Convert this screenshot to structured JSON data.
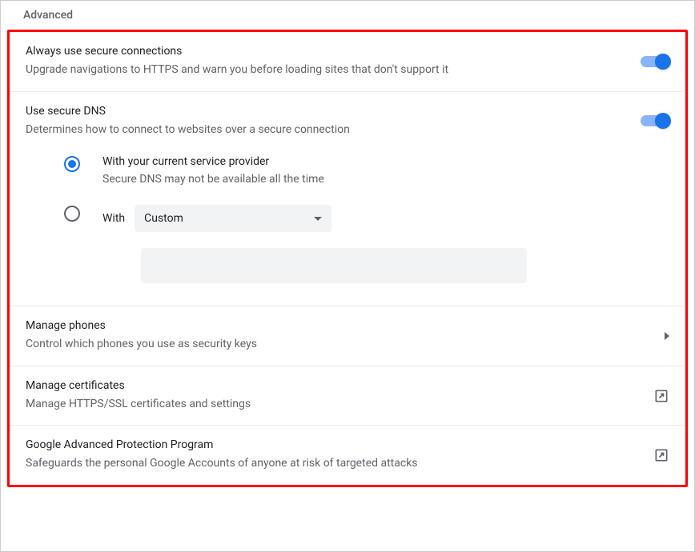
{
  "sectionHeader": "Advanced",
  "secureConnections": {
    "title": "Always use secure connections",
    "desc": "Upgrade navigations to HTTPS and warn you before loading sites that don't support it",
    "enabled": true
  },
  "secureDns": {
    "title": "Use secure DNS",
    "desc": "Determines how to connect to websites over a secure connection",
    "enabled": true,
    "options": {
      "current": {
        "label": "With your current service provider",
        "desc": "Secure DNS may not be available all the time",
        "selected": true
      },
      "custom": {
        "prefix": "With",
        "dropdownValue": "Custom",
        "inputValue": "",
        "selected": false
      }
    }
  },
  "managePhones": {
    "title": "Manage phones",
    "desc": "Control which phones you use as security keys"
  },
  "manageCertificates": {
    "title": "Manage certificates",
    "desc": "Manage HTTPS/SSL certificates and settings"
  },
  "advancedProtection": {
    "title": "Google Advanced Protection Program",
    "desc": "Safeguards the personal Google Accounts of anyone at risk of targeted attacks"
  }
}
